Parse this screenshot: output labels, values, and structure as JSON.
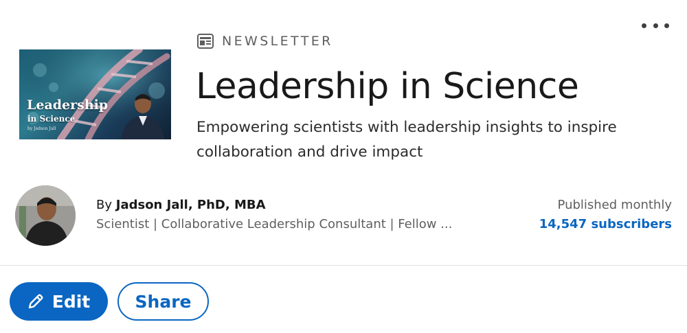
{
  "newsletter": {
    "kind_label": "NEWSLETTER",
    "kind_icon": "newsletter-icon",
    "title": "Leadership in Science",
    "description": "Empowering scientists with leadership insights to inspire collaboration and drive impact",
    "cover": {
      "title": "Leadership",
      "subtitle": "in Science",
      "byline": "by Jadson Jall"
    }
  },
  "author": {
    "prefix": "By",
    "name": "Jadson Jall, PhD, MBA",
    "headline": "Scientist | Collaborative Leadership Consultant | Fellow ..."
  },
  "stats": {
    "frequency": "Published monthly",
    "subscribers": "14,547 subscribers"
  },
  "actions": {
    "edit_label": "Edit",
    "edit_icon": "pencil-icon",
    "share_label": "Share",
    "more_icon": "more-options-icon"
  },
  "colors": {
    "accent": "#0a66c2",
    "text_primary": "#191919",
    "text_secondary": "#5e5e5e",
    "divider": "#e0dfdc"
  }
}
